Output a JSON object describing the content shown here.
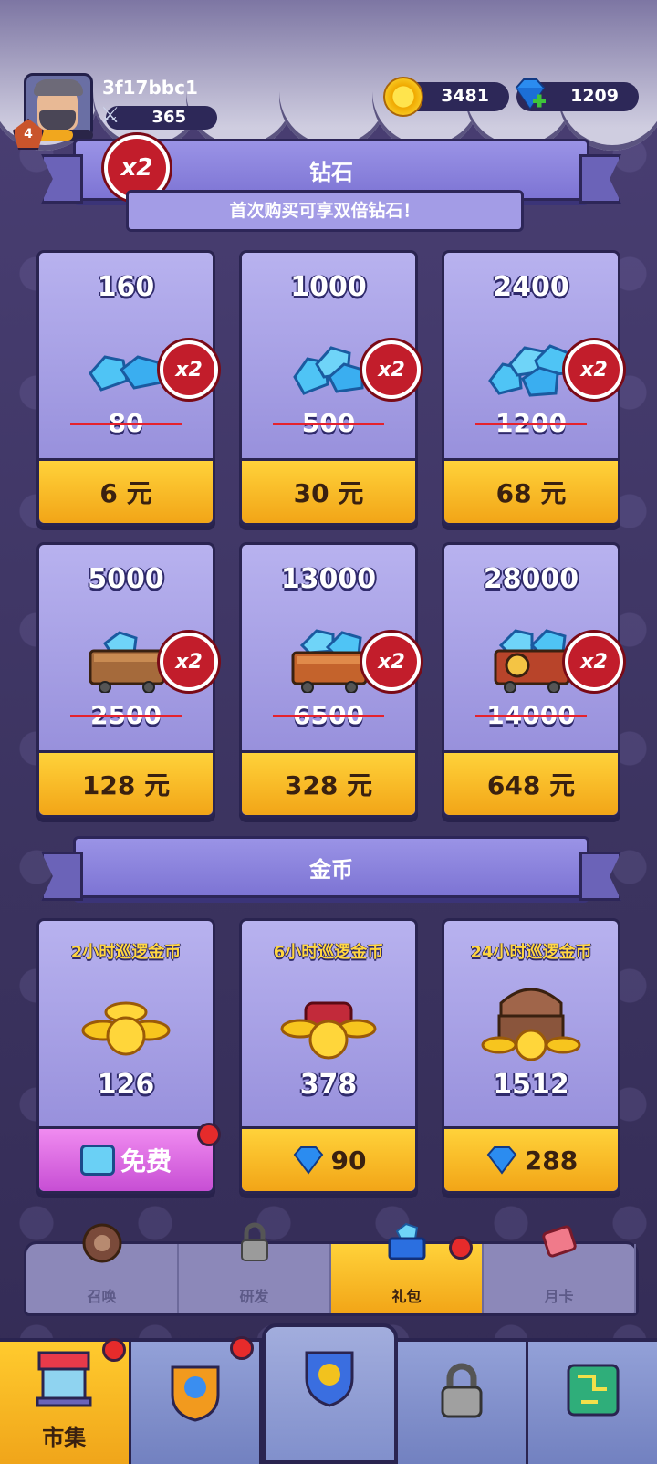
{
  "player": {
    "name": "3f17bbc1",
    "level": "4",
    "power": "365",
    "xp_fraction": 0.65
  },
  "currency": {
    "gold": "3481",
    "gems": "1209"
  },
  "gem_section": {
    "title": "钻石",
    "badge": "x2",
    "promo": "首次购买可享双倍钻石！",
    "items": [
      {
        "amount": "160",
        "original": "80",
        "price": "6 元",
        "badge": "x2"
      },
      {
        "amount": "1000",
        "original": "500",
        "price": "30 元",
        "badge": "x2"
      },
      {
        "amount": "2400",
        "original": "1200",
        "price": "68 元",
        "badge": "x2"
      },
      {
        "amount": "5000",
        "original": "2500",
        "price": "128 元",
        "badge": "x2"
      },
      {
        "amount": "13000",
        "original": "6500",
        "price": "328 元",
        "badge": "x2"
      },
      {
        "amount": "28000",
        "original": "14000",
        "price": "648 元",
        "badge": "x2"
      }
    ]
  },
  "gold_section": {
    "title": "金币",
    "items": [
      {
        "title": "2小时巡逻金币",
        "amount": "126",
        "price": "免费",
        "price_icon": "video-icon"
      },
      {
        "title": "6小时巡逻金币",
        "amount": "378",
        "price": "90",
        "price_icon": "gem-icon"
      },
      {
        "title": "24小时巡逻金币",
        "amount": "1512",
        "price": "288",
        "price_icon": "gem-icon"
      }
    ]
  },
  "sub_tabs": [
    {
      "label": "召唤",
      "icon": "summon-icon"
    },
    {
      "label": "研发",
      "icon": "lock-icon"
    },
    {
      "label": "礼包",
      "icon": "basket-icon",
      "active": true
    },
    {
      "label": "月卡",
      "icon": "card-icon"
    }
  ],
  "bottom_nav": [
    {
      "label": "市集",
      "icon": "shop-icon",
      "active": true
    },
    {
      "label": "",
      "icon": "hero-icon"
    },
    {
      "label": "",
      "icon": "shield-icon"
    },
    {
      "label": "",
      "icon": "lock-icon"
    },
    {
      "label": "",
      "icon": "circuit-icon"
    }
  ],
  "colors": {
    "accent": "#f2a517",
    "badge": "#c21d2b",
    "card": "#a9a2e6"
  }
}
